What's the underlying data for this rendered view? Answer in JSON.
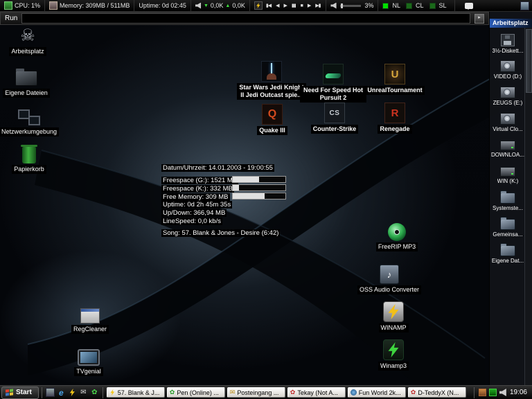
{
  "colors": {
    "lock_nl": "#00e000",
    "lock_cl": "#1a6a1a",
    "lock_sl": "#1a6a1a",
    "title_blue": "#2a5cb8"
  },
  "monitor_bar": {
    "cpu": "CPU: 1%",
    "memory": "Memory: 309MB / 511MB",
    "uptime": "Uptime: 0d 02:45",
    "net_down_arrow": "▼",
    "net_down": "0,0K",
    "net_up_arrow": "▲",
    "net_up": "0,0K",
    "media_controls": [
      "▮◀",
      "◀",
      "▶",
      "▮▮",
      "■",
      "▶",
      "▶▮"
    ],
    "volume": "3%",
    "lock_nl_label": "NL",
    "lock_cl_label": "CL",
    "lock_sl_label": "SL"
  },
  "run_bar": {
    "label": "Run",
    "value": "",
    "go": "▸"
  },
  "icons": {
    "arbeitsplatz": "Arbeitsplatz",
    "eigene_dateien": "Eigene Dateien",
    "netzwerk": "Netzwerkumgebung",
    "papierkorb": "Papierkorb",
    "regcleaner": "RegCleaner",
    "tvgenial": "TVgenial",
    "jedi": "Star Wars Jedi Knight II Jedi Outcast spie...",
    "nfs": "Need For Speed Hot Pursuit 2",
    "ut": "UnrealTournament",
    "quake3": "Quake III",
    "cs": "Counter-Strike",
    "renegade": "Renegade",
    "freerip": "FreeRIP MP3",
    "oss": "OSS Audio Converter",
    "winamp": "WINAMP",
    "winamp3": "Winamp3"
  },
  "glyphs": {
    "skull": "☠",
    "ut": "U",
    "quake": "Q",
    "cs": "CS",
    "renegade": "R",
    "note": "♪",
    "ie": "e",
    "envelope": "✉",
    "flower": "✿"
  },
  "sysinfo": {
    "datetime": "Datum/Uhrzeit: 14.01.2003 - 19:00:55",
    "freespace_g": "Freespace (G:): 1521 MB",
    "freespace_k": "Freespace (K:): 332 MB",
    "free_memory": "Free Memory: 309 MB",
    "uptime": "Uptime: 0d 2h 45m 35s",
    "updown": "Up/Down: 366,94 MB",
    "linespeed": "LineSpeed: 0,0 kb/s",
    "song": "Song: 57. Blank & Jones - Desire (6:42)",
    "bars": {
      "g_pct": 50,
      "k_pct": 12,
      "mem_pct": 60
    }
  },
  "sidebar": {
    "title": "Arbeitsplatz",
    "items": [
      "3½-Diskett...",
      "VIDEO (D:)",
      "ZEUGS (E:)",
      "Virtual Clo...",
      "DOWNLOA...",
      "WIN (K:)",
      "Systemste...",
      "Gemeinsa...",
      "Eigene Dat..."
    ]
  },
  "taskbar": {
    "start": "Start",
    "tasks": [
      "57. Blank & J...",
      "Pen (Online) ...",
      "Posteingang ...",
      "Tekay (Not A...",
      "Fun World 2k...",
      "D-TeddyX (N..."
    ],
    "clock": "19:06"
  }
}
